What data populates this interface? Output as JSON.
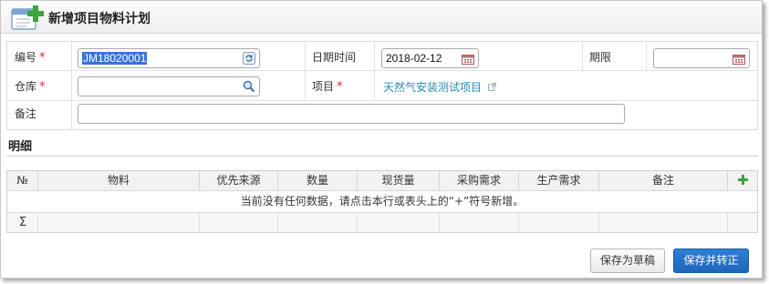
{
  "window": {
    "title": "新增项目物料计划"
  },
  "form": {
    "code": {
      "label": "编号",
      "required_mark": "*",
      "value": "JM18020001"
    },
    "datetime": {
      "label": "日期时间",
      "value": "2018-02-12"
    },
    "deadline": {
      "label": "期限",
      "value": ""
    },
    "warehouse": {
      "label": "仓库",
      "required_mark": "*",
      "value": ""
    },
    "project": {
      "label": "项目",
      "required_mark": "*",
      "link_text": "天然气安装测试项目"
    },
    "remark": {
      "label": "备注",
      "value": ""
    }
  },
  "detail": {
    "section_title": "明细",
    "columns": [
      "№",
      "物料",
      "优先来源",
      "数量",
      "现货量",
      "采购需求",
      "生产需求",
      "备注"
    ],
    "add_icon": "plus-icon",
    "empty_message": "当前没有任何数据，请点击本行或表头上的“+”符号新增。",
    "sum_symbol": "Σ"
  },
  "buttons": {
    "save_draft": "保存为草稿",
    "save_convert": "保存并转正"
  },
  "colors": {
    "primary_button": "#2173c6",
    "link": "#2a8ab5",
    "required": "#d9282f",
    "add_icon": "#3aa53a",
    "selection": "#3874d8"
  }
}
